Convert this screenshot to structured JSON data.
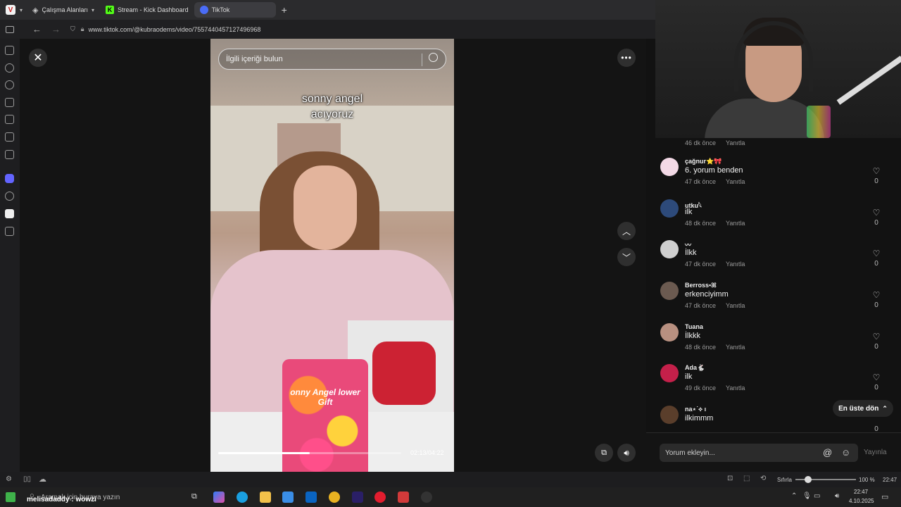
{
  "browser": {
    "tabs": [
      {
        "label": "Çalışma Alanları"
      },
      {
        "label": "Stream - Kick Dashboard"
      },
      {
        "label": "TikTok"
      }
    ],
    "url": "www.tiktok.com/@kubraodems/video/7557440457127496968"
  },
  "video": {
    "search_placeholder": "İlgili içeriği bulun",
    "caption_line1": "sonny angel",
    "caption_line2": "acıyoruz",
    "can_label": "onny Angel lower Gift",
    "time": "02:13/04:22",
    "progress_fraction": 0.5
  },
  "comments": {
    "top_meta": {
      "time": "46 dk önce",
      "reply": "Yanıtla"
    },
    "items": [
      {
        "user": "çağnur⭐🎀",
        "text": "6. yorum benden",
        "time": "47 dk önce",
        "reply": "Yanıtla",
        "likes": "0",
        "avatar_color": "#f3d9e6"
      },
      {
        "user": "utku𓆩",
        "text": "ilk",
        "time": "48 dk önce",
        "reply": "Yanıtla",
        "likes": "0",
        "avatar_color": "#2d4a7a"
      },
      {
        "user": "〰",
        "text": "İlkk",
        "time": "47 dk önce",
        "reply": "Yanıtla",
        "likes": "0",
        "avatar_color": "#cfcfcf"
      },
      {
        "user": "Berross▪︎ꕤ",
        "text": "erkenciyimm",
        "time": "47 dk önce",
        "reply": "Yanıtla",
        "likes": "0",
        "avatar_color": "#6b5a50"
      },
      {
        "user": "Tuana",
        "text": "İlkkk",
        "time": "48 dk önce",
        "reply": "Yanıtla",
        "likes": "0",
        "avatar_color": "#b89080"
      },
      {
        "user": "Ada🐇",
        "text": "ilk",
        "time": "49 dk önce",
        "reply": "Yanıtla",
        "likes": "0",
        "avatar_color": "#c4204a"
      },
      {
        "user": "na⋆˙⟡ ı",
        "text": "ilkimmm",
        "time": "",
        "reply": "",
        "likes": "0",
        "avatar_color": "#5a3e2b"
      }
    ],
    "to_top": "En üste dön",
    "input_placeholder": "Yorum ekleyin...",
    "post": "Yayınla"
  },
  "statusbar": {
    "reset": "Sıfırla",
    "zoom": "100 %",
    "time": "22:47"
  },
  "taskbar": {
    "search_text": "Aramak için buraya yazın",
    "overlay_name": "melisadaddy : wowzi",
    "time": "22:47",
    "date": "4.10.2025"
  },
  "colors": {
    "accent": "#fe2c55",
    "panel": "#121212"
  }
}
